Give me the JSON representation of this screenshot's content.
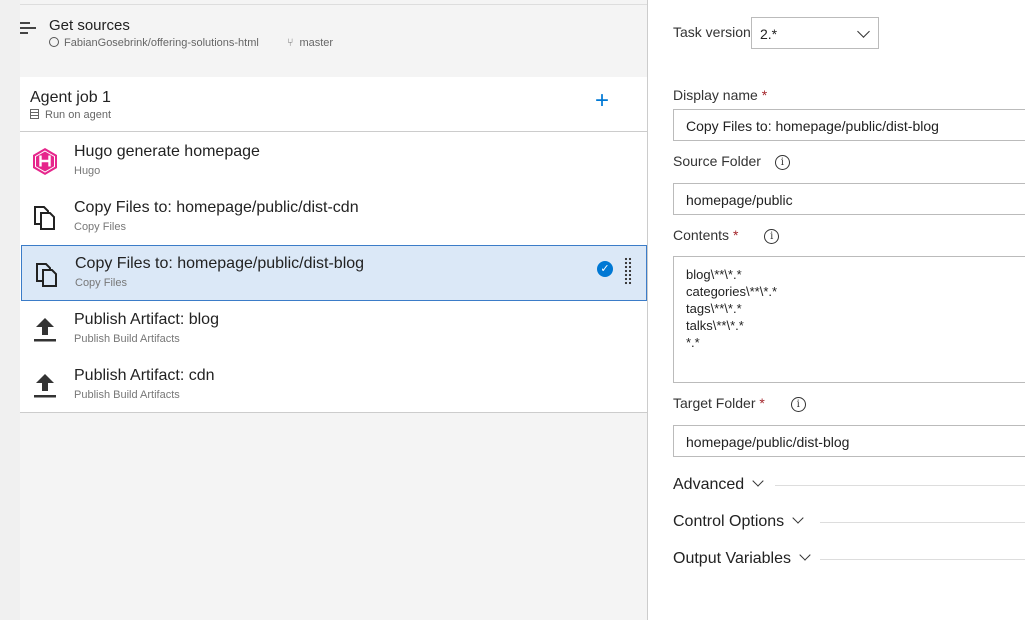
{
  "get_sources": {
    "title": "Get sources",
    "repo": "FabianGosebrink/offering-solutions-html",
    "branch": "master"
  },
  "agent_job": {
    "title": "Agent job 1",
    "subtitle": "Run on agent",
    "add_glyph": "+"
  },
  "tasks": [
    {
      "title": "Hugo generate homepage",
      "subtitle": "Hugo",
      "icon": "hugo-icon"
    },
    {
      "title": "Copy Files to: homepage/public/dist-cdn",
      "subtitle": "Copy Files",
      "icon": "copy-files-icon"
    },
    {
      "title": "Copy Files to: homepage/public/dist-blog",
      "subtitle": "Copy Files",
      "icon": "copy-files-icon",
      "selected": true
    },
    {
      "title": "Publish Artifact: blog",
      "subtitle": "Publish Build Artifacts",
      "icon": "upload-icon"
    },
    {
      "title": "Publish Artifact: cdn",
      "subtitle": "Publish Build Artifacts",
      "icon": "upload-icon"
    }
  ],
  "form": {
    "task_version_label": "Task version",
    "task_version_value": "2.*",
    "display_name_label": "Display name",
    "display_name_value": "Copy Files to: homepage/public/dist-blog",
    "source_folder_label": "Source Folder",
    "source_folder_value": "homepage/public",
    "contents_label": "Contents",
    "contents_lines": [
      "blog\\**\\*.*",
      "categories\\**\\*.*",
      "tags\\**\\*.*",
      "talks\\**\\*.*",
      "*.*"
    ],
    "target_folder_label": "Target Folder",
    "target_folder_value": "homepage/public/dist-blog",
    "required_mark": "*",
    "info_glyph": "i"
  },
  "sections": {
    "advanced": "Advanced",
    "control_options": "Control Options",
    "output_variables": "Output Variables"
  },
  "colors": {
    "accent": "#0078d4",
    "selected_bg": "#dbe8f7",
    "hugo_pink": "#e6268c"
  }
}
